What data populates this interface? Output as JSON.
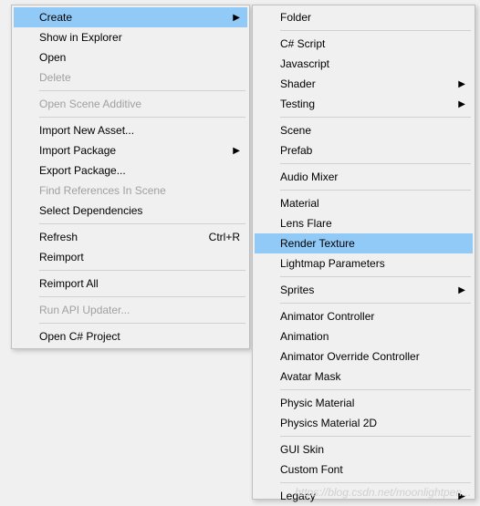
{
  "leftMenu": {
    "items": [
      {
        "label": "Create",
        "hasSubmenu": true,
        "selected": true,
        "enabled": true
      },
      {
        "label": "Show in Explorer",
        "enabled": true
      },
      {
        "label": "Open",
        "enabled": true
      },
      {
        "label": "Delete",
        "enabled": false
      },
      {
        "separator": true
      },
      {
        "label": "Open Scene Additive",
        "enabled": false
      },
      {
        "separator": true
      },
      {
        "label": "Import New Asset...",
        "enabled": true
      },
      {
        "label": "Import Package",
        "hasSubmenu": true,
        "enabled": true
      },
      {
        "label": "Export Package...",
        "enabled": true
      },
      {
        "label": "Find References In Scene",
        "enabled": false
      },
      {
        "label": "Select Dependencies",
        "enabled": true
      },
      {
        "separator": true
      },
      {
        "label": "Refresh",
        "shortcut": "Ctrl+R",
        "enabled": true
      },
      {
        "label": "Reimport",
        "enabled": true
      },
      {
        "separator": true
      },
      {
        "label": "Reimport All",
        "enabled": true
      },
      {
        "separator": true
      },
      {
        "label": "Run API Updater...",
        "enabled": false
      },
      {
        "separator": true
      },
      {
        "label": "Open C# Project",
        "enabled": true
      }
    ]
  },
  "rightMenu": {
    "items": [
      {
        "label": "Folder",
        "enabled": true
      },
      {
        "separator": true
      },
      {
        "label": "C# Script",
        "enabled": true
      },
      {
        "label": "Javascript",
        "enabled": true
      },
      {
        "label": "Shader",
        "hasSubmenu": true,
        "enabled": true
      },
      {
        "label": "Testing",
        "hasSubmenu": true,
        "enabled": true
      },
      {
        "separator": true
      },
      {
        "label": "Scene",
        "enabled": true
      },
      {
        "label": "Prefab",
        "enabled": true
      },
      {
        "separator": true
      },
      {
        "label": "Audio Mixer",
        "enabled": true
      },
      {
        "separator": true
      },
      {
        "label": "Material",
        "enabled": true
      },
      {
        "label": "Lens Flare",
        "enabled": true
      },
      {
        "label": "Render Texture",
        "highlighted": true,
        "enabled": true
      },
      {
        "label": "Lightmap Parameters",
        "enabled": true
      },
      {
        "separator": true
      },
      {
        "label": "Sprites",
        "hasSubmenu": true,
        "enabled": true
      },
      {
        "separator": true
      },
      {
        "label": "Animator Controller",
        "enabled": true
      },
      {
        "label": "Animation",
        "enabled": true
      },
      {
        "label": "Animator Override Controller",
        "enabled": true
      },
      {
        "label": "Avatar Mask",
        "enabled": true
      },
      {
        "separator": true
      },
      {
        "label": "Physic Material",
        "enabled": true
      },
      {
        "label": "Physics Material 2D",
        "enabled": true
      },
      {
        "separator": true
      },
      {
        "label": "GUI Skin",
        "enabled": true
      },
      {
        "label": "Custom Font",
        "enabled": true
      },
      {
        "separator": true
      },
      {
        "label": "Legacy",
        "hasSubmenu": true,
        "enabled": true
      }
    ]
  },
  "watermark": "https://blog.csdn.net/moonlightpen..."
}
